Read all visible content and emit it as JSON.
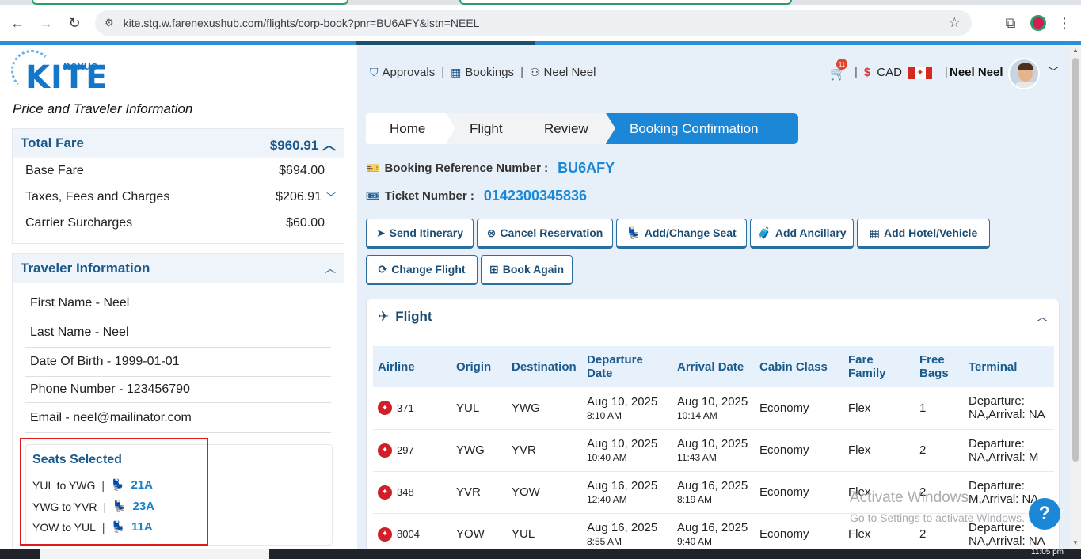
{
  "browser": {
    "url": "kite.stg.w.farenexushub.com/flights/corp-book?pnr=BU6AFY&lstn=NEEL"
  },
  "brand": {
    "logo_main": "KITE",
    "logo_sub": "nexus"
  },
  "left": {
    "section_title": "Price and Traveler Information",
    "fare": {
      "title": "Total Fare",
      "total": "$960.91",
      "rows": [
        {
          "label": "Base Fare",
          "value": "$694.00"
        },
        {
          "label": "Taxes, Fees and Charges",
          "value": "$206.91"
        },
        {
          "label": "Carrier Surcharges",
          "value": "$60.00"
        }
      ]
    },
    "traveler": {
      "title": "Traveler Information",
      "rows": [
        "First Name - Neel",
        "Last Name - Neel",
        "Date Of Birth - 1999-01-01",
        "Phone Number - 123456790",
        "Email - neel@mailinator.com"
      ]
    },
    "seats": {
      "title": "Seats Selected",
      "items": [
        {
          "route": "YUL to YWG",
          "seat": "21A"
        },
        {
          "route": "YWG to YVR",
          "seat": "23A"
        },
        {
          "route": "YOW to YUL",
          "seat": "11A"
        }
      ]
    }
  },
  "header": {
    "approvals": "Approvals",
    "bookings": "Bookings",
    "user_link": "Neel Neel",
    "cart_count": "11",
    "currency_symbol": "$",
    "currency": "CAD",
    "user_name": "Neel Neel"
  },
  "breadcrumbs": [
    "Home",
    "Flight",
    "Review",
    "Booking Confirmation"
  ],
  "booking": {
    "ref_label": "Booking Reference Number :",
    "ref_value": "BU6AFY",
    "ticket_label": "Ticket Number :",
    "ticket_value": "0142300345836"
  },
  "actions": [
    "Send Itinerary",
    "Cancel Reservation",
    "Add/Change Seat",
    "Add Ancillary",
    "Add Hotel/Vehicle",
    "Change Flight",
    "Book Again"
  ],
  "flight": {
    "title": "Flight",
    "columns": [
      "Airline",
      "Origin",
      "Destination",
      "Departure Date",
      "Arrival Date",
      "Cabin Class",
      "Fare Family",
      "Free Bags",
      "Terminal"
    ],
    "rows": [
      {
        "airline": "371",
        "origin": "YUL",
        "dest": "YWG",
        "dep_date": "Aug 10, 2025",
        "dep_time": "8:10 AM",
        "arr_date": "Aug 10, 2025",
        "arr_time": "10:14 AM",
        "cabin": "Economy",
        "fare_family": "Flex",
        "bags": "1",
        "terminal": "Departure: NA,Arrival: NA"
      },
      {
        "airline": "297",
        "origin": "YWG",
        "dest": "YVR",
        "dep_date": "Aug 10, 2025",
        "dep_time": "10:40 AM",
        "arr_date": "Aug 10, 2025",
        "arr_time": "11:43 AM",
        "cabin": "Economy",
        "fare_family": "Flex",
        "bags": "2",
        "terminal": "Departure: NA,Arrival: M"
      },
      {
        "airline": "348",
        "origin": "YVR",
        "dest": "YOW",
        "dep_date": "Aug 16, 2025",
        "dep_time": "12:40 AM",
        "arr_date": "Aug 16, 2025",
        "arr_time": "8:19 AM",
        "cabin": "Economy",
        "fare_family": "Flex",
        "bags": "2",
        "terminal": "Departure: M,Arrival: NA"
      },
      {
        "airline": "8004",
        "origin": "YOW",
        "dest": "YUL",
        "dep_date": "Aug 16, 2025",
        "dep_time": "8:55 AM",
        "arr_date": "Aug 16, 2025",
        "arr_time": "9:40 AM",
        "cabin": "Economy",
        "fare_family": "Flex",
        "bags": "2",
        "terminal": "Departure: NA,Arrival: NA"
      }
    ]
  },
  "watermark": {
    "line1": "Activate Windows",
    "line2": "Go to Settings to activate Windows."
  },
  "help_label": "?",
  "taskbar": {
    "clock": "11:05 pm"
  },
  "icons": {
    "back": "arrow-left-icon",
    "forward": "arrow-right-icon",
    "reload": "reload-icon",
    "star": "star-icon",
    "extensions": "puzzle-icon",
    "menu": "kebab-icon",
    "cart": "cart-icon",
    "seat": "seat-icon",
    "plane": "plane-icon"
  }
}
